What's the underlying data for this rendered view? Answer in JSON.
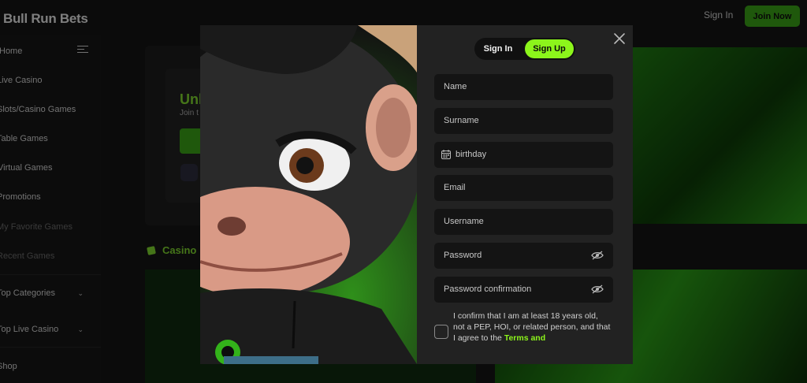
{
  "app": {
    "logo": "Bull Run Bets",
    "header": {
      "sign_in": "Sign In",
      "join_now": "Join Now"
    }
  },
  "sidebar": {
    "items": [
      {
        "label": "Home"
      },
      {
        "label": "Live Casino"
      },
      {
        "label": "Slots/Casino Games"
      },
      {
        "label": "Table Games"
      },
      {
        "label": "Virtual Games"
      },
      {
        "label": "Promotions"
      },
      {
        "label": "My Favorite Games"
      },
      {
        "label": "Recent Games"
      },
      {
        "label": "Top Categories"
      },
      {
        "label": "Top Live Casino"
      },
      {
        "label": "Shop"
      }
    ]
  },
  "background": {
    "hero_title": "Unl",
    "hero_sub": "Join t",
    "section_title": "Casino"
  },
  "modal": {
    "tabs": {
      "sign_in": "Sign In",
      "sign_up": "Sign Up"
    },
    "fields": [
      {
        "label": "Name",
        "icon": ""
      },
      {
        "label": "Surname",
        "icon": ""
      },
      {
        "label": "birthday",
        "icon": "calendar-icon"
      },
      {
        "label": "Email",
        "icon": ""
      },
      {
        "label": "Username",
        "icon": ""
      },
      {
        "label": "Password",
        "icon": "eye-off-icon"
      },
      {
        "label": "Password confirmation",
        "icon": "eye-off-icon"
      }
    ],
    "confirm_text": "I confirm that I am at least 18 years old, not a PEP, HOI, or related person, and that I agree to the",
    "terms_link": "Terms and"
  },
  "colors": {
    "accent": "#8cf51b",
    "brand_green": "#3aa016",
    "modal_bg": "#222222",
    "field_bg": "#141414"
  }
}
